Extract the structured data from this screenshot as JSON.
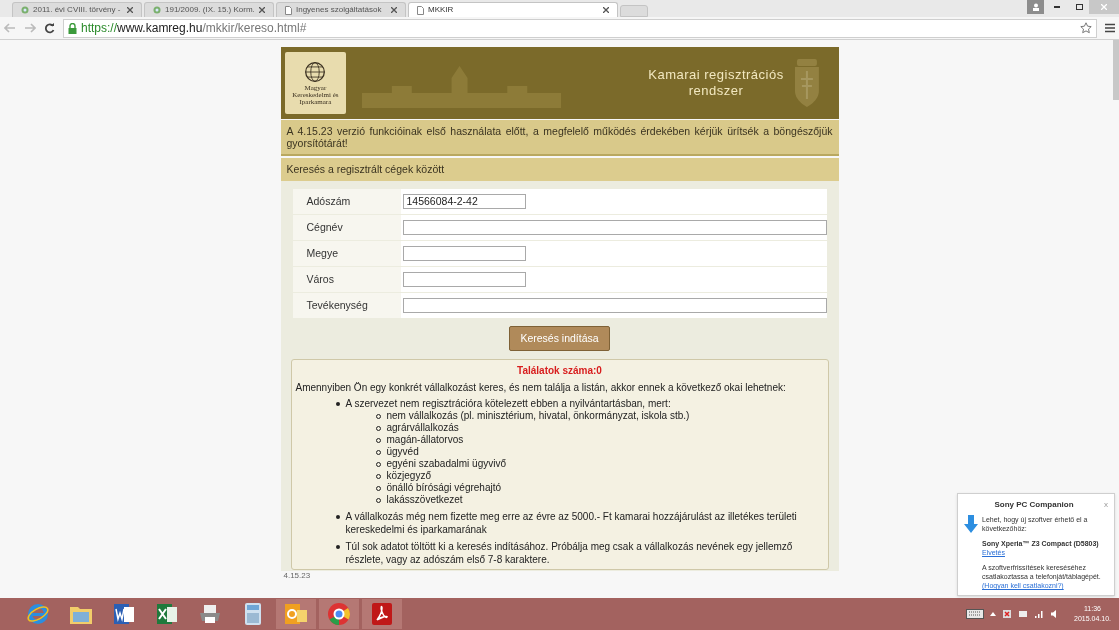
{
  "browser": {
    "tabs": [
      {
        "label": "2011. évi CVIII. törvény -",
        "kind": "globe",
        "selected": false
      },
      {
        "label": "191/2009. (IX. 15.) Korm.",
        "kind": "globe",
        "selected": false
      },
      {
        "label": "Ingyenes szolgáltatások",
        "kind": "page",
        "selected": false
      },
      {
        "label": "MKKIR",
        "kind": "page",
        "selected": true
      }
    ],
    "url": {
      "scheme": "https://",
      "host": "www.kamreg.hu",
      "path": "/mkkir/kereso.html#"
    }
  },
  "header": {
    "logo_text": "Magyar Kereskedelmi és Iparkamara",
    "title": "Kamarai regisztrációs rendszer"
  },
  "notice": "A 4.15.23 verzió funkcióinak első használata előtt, a megfelelő működés érdekében kérjük ürítsék a böngészőjük gyorsítótárát!",
  "search": {
    "title": "Keresés a regisztrált cégek között",
    "fields": [
      {
        "label": "Adószám",
        "value": "14566084-2-42",
        "kind": "short"
      },
      {
        "label": "Cégnév",
        "kind": "long"
      },
      {
        "label": "Megye",
        "kind": "short"
      },
      {
        "label": "Város",
        "kind": "short"
      },
      {
        "label": "Tevékenység",
        "kind": "long"
      }
    ],
    "button": "Keresés indítása"
  },
  "results": {
    "count": "Találatok száma:0",
    "intro": "Amennyiben Ön egy konkrét vállalkozást keres, és nem találja a listán, akkor ennek a következő okai lehetnek:",
    "reasons": [
      {
        "text": "A szervezet nem regisztrációra kötelezett ebben a nyilvántartásban, mert:",
        "children": [
          "nem vállalkozás (pl. minisztérium, hivatal, önkormányzat, iskola stb.)",
          "agrárvállalkozás",
          "magán-állatorvos",
          "ügyvéd",
          "egyéni szabadalmi ügyvivő",
          "közjegyző",
          "önálló bírósági végrehajtó",
          "lakásszövetkezet"
        ]
      },
      {
        "text": "A vállalkozás még nem fizette meg erre az évre az 5000.- Ft kamarai hozzájárulást az illetékes területi kereskedelmi és iparkamarának"
      },
      {
        "text": "Túl sok adatot töltött ki a keresés indításához. Próbálja meg csak a vállalkozás nevének egy jellemző részlete, vagy az adószám első 7-8 karaktere."
      }
    ]
  },
  "version": "4.15.23",
  "notification": {
    "title": "Sony PC Companion",
    "close": "x",
    "message": "Lehet, hogy új szoftver érhető el a következőhöz:",
    "device": "Sony Xperia™ Z3 Compact (D5803)",
    "dismiss": "Elvetés",
    "hint": "A szoftverfrissítések kereséséhez csatlakoztassa a telefonját/táblagépét.",
    "hint_link": "(Hogyan kell csatlakozni?)"
  },
  "taskbar": {
    "apps": [
      {
        "kind": "ie"
      },
      {
        "kind": "folder"
      },
      {
        "kind": "word"
      },
      {
        "kind": "excel"
      },
      {
        "kind": "printer"
      },
      {
        "kind": "calculator"
      },
      {
        "kind": "outlook"
      },
      {
        "kind": "chrome"
      },
      {
        "kind": "pdf"
      }
    ],
    "time": "11:36",
    "date": "2015.04.10."
  }
}
